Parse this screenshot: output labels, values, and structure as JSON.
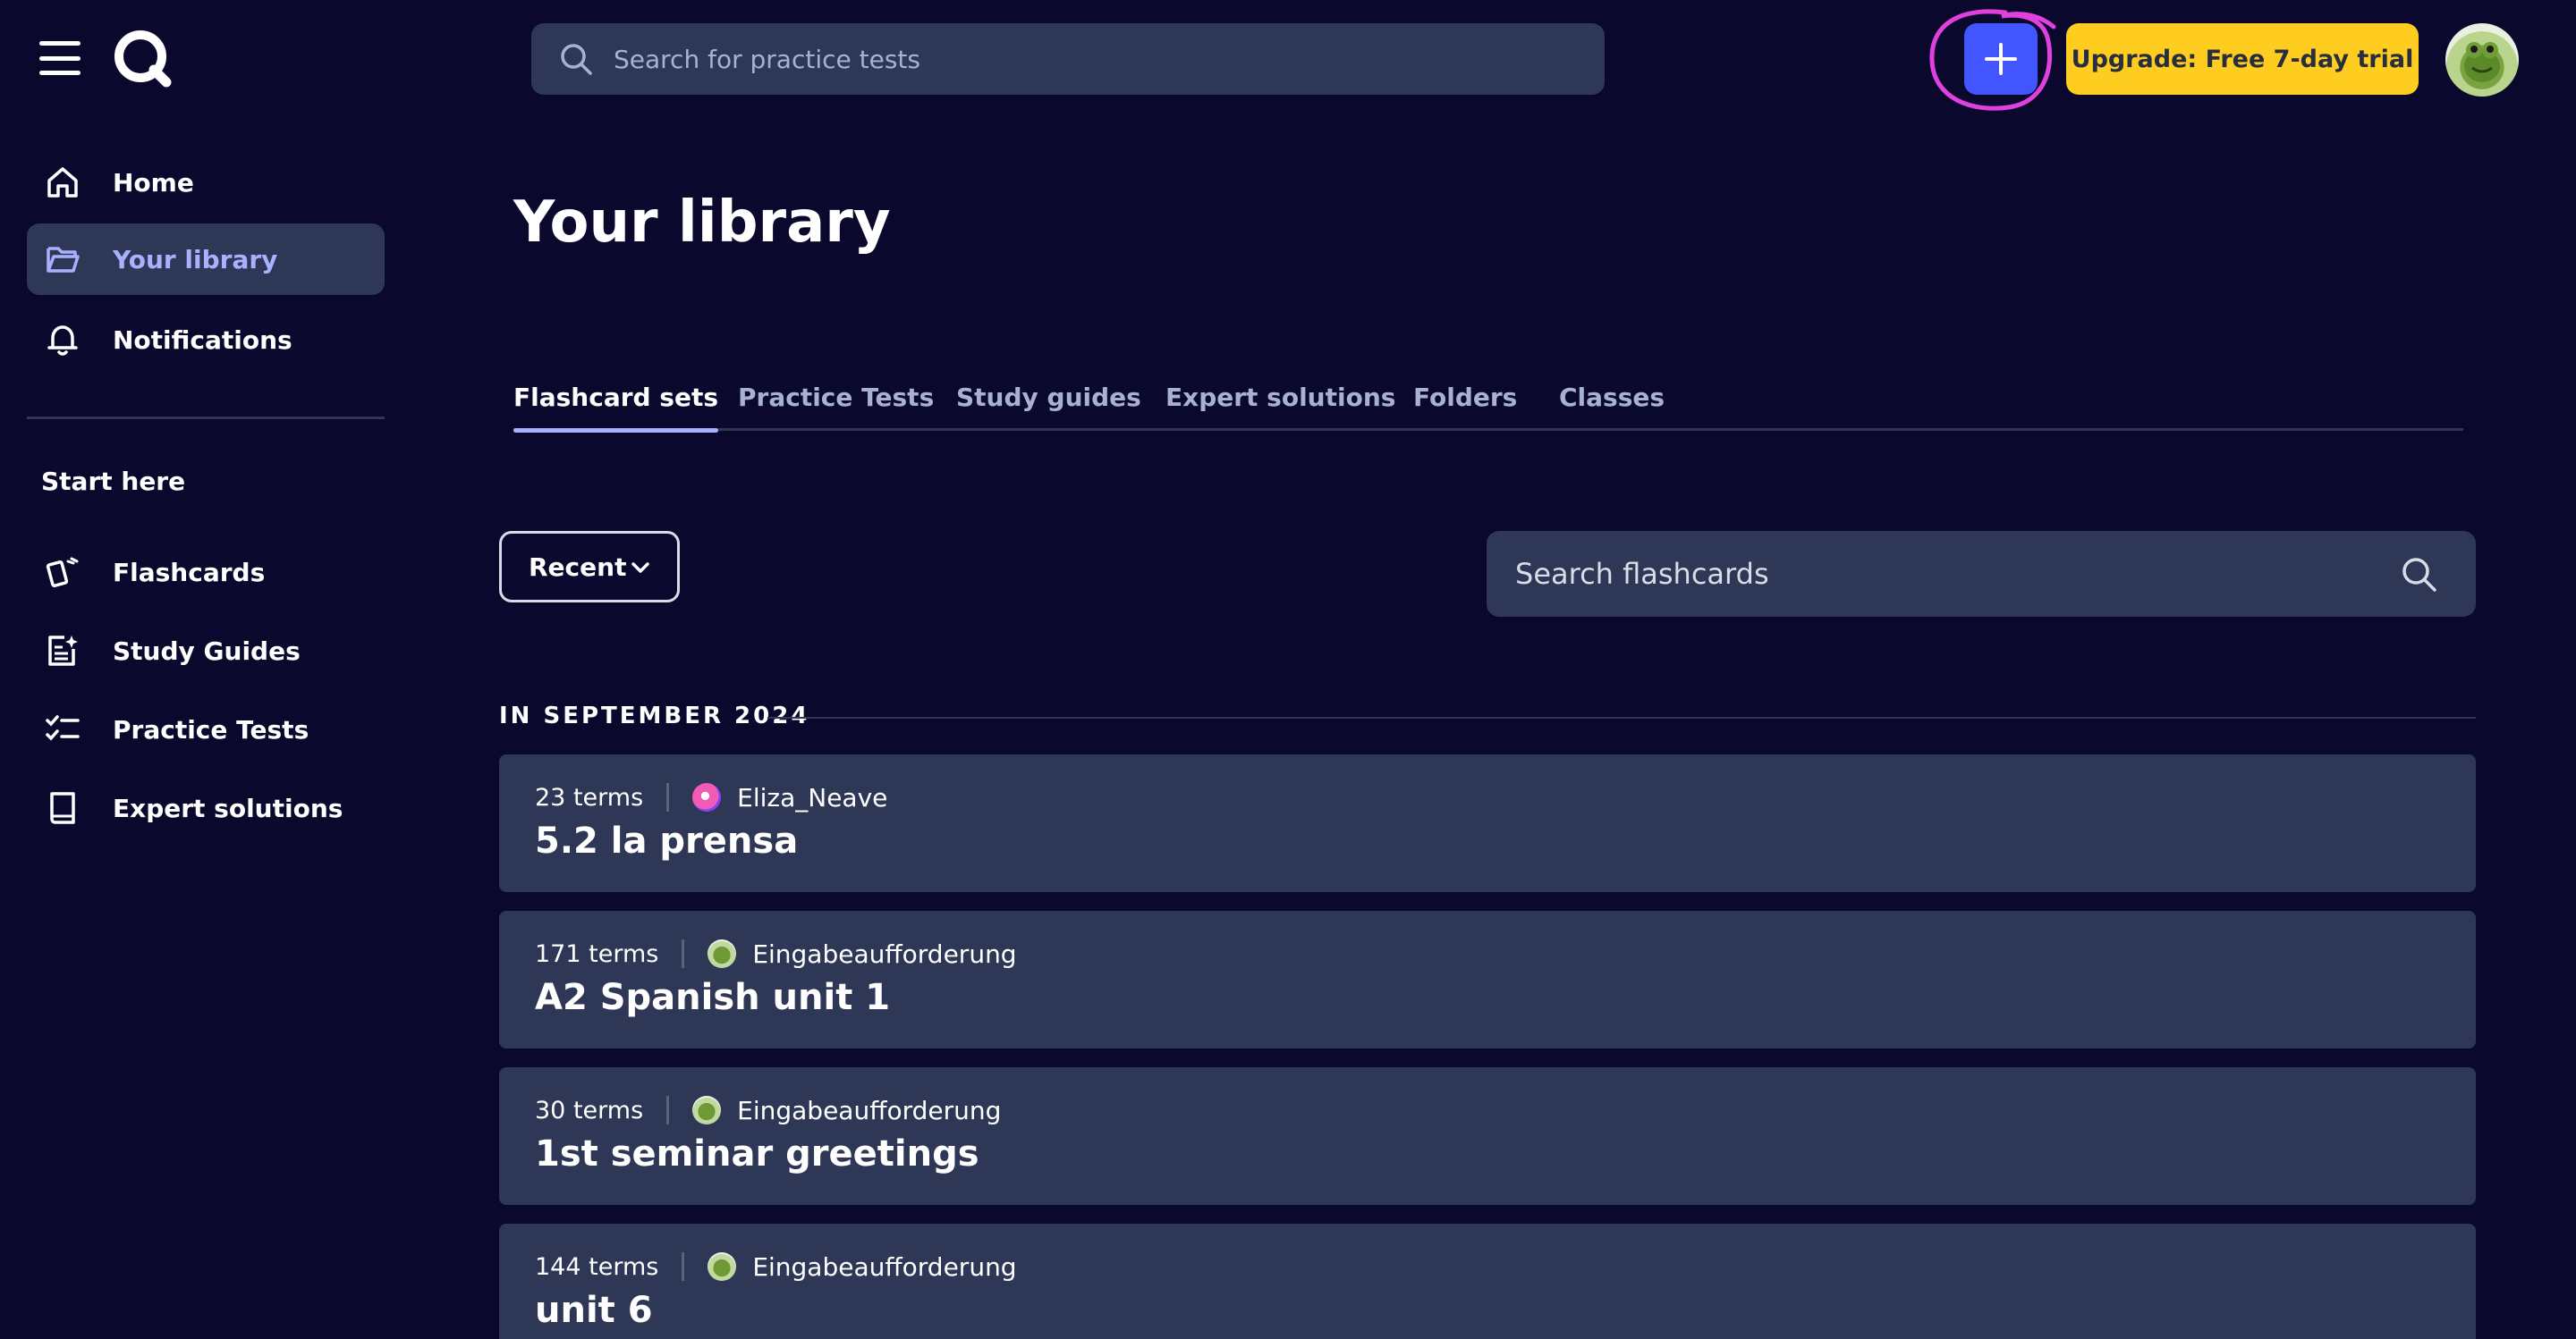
{
  "topbar": {
    "search_placeholder": "Search for practice tests",
    "create_label": "+",
    "upgrade_label": "Upgrade: Free 7-day trial"
  },
  "sidebar": {
    "nav": [
      {
        "label": "Home",
        "icon": "home-icon"
      },
      {
        "label": "Your library",
        "icon": "folder-icon",
        "active": true
      },
      {
        "label": "Notifications",
        "icon": "bell-icon"
      }
    ],
    "section_title": "Start here",
    "start_items": [
      {
        "label": "Flashcards",
        "icon": "flashcards-icon"
      },
      {
        "label": "Study Guides",
        "icon": "study-guide-icon"
      },
      {
        "label": "Practice Tests",
        "icon": "checklist-icon"
      },
      {
        "label": "Expert solutions",
        "icon": "book-icon"
      }
    ]
  },
  "main": {
    "title": "Your library",
    "tabs": [
      {
        "label": "Flashcard sets",
        "active": true
      },
      {
        "label": "Practice Tests"
      },
      {
        "label": "Study guides"
      },
      {
        "label": "Expert solutions"
      },
      {
        "label": "Folders"
      },
      {
        "label": "Classes"
      }
    ],
    "sort": {
      "selected": "Recent"
    },
    "filter_placeholder": "Search flashcards",
    "group_heading": "IN SEPTEMBER 2024",
    "sets": [
      {
        "terms": "23 terms",
        "creator": "Eliza_Neave",
        "title": "5.2 la prensa"
      },
      {
        "terms": "171 terms",
        "creator": "Eingabeaufforderung",
        "title": "A2 Spanish unit 1"
      },
      {
        "terms": "30 terms",
        "creator": "Eingabeaufforderung",
        "title": "1st seminar greetings"
      },
      {
        "terms": "144 terms",
        "creator": "Eingabeaufforderung",
        "title": "unit 6"
      }
    ]
  },
  "colors": {
    "background": "#0a092d",
    "card": "#2e3856",
    "accent": "#4255ff",
    "upgrade": "#ffcd1f",
    "annotation": "#e040e0"
  }
}
